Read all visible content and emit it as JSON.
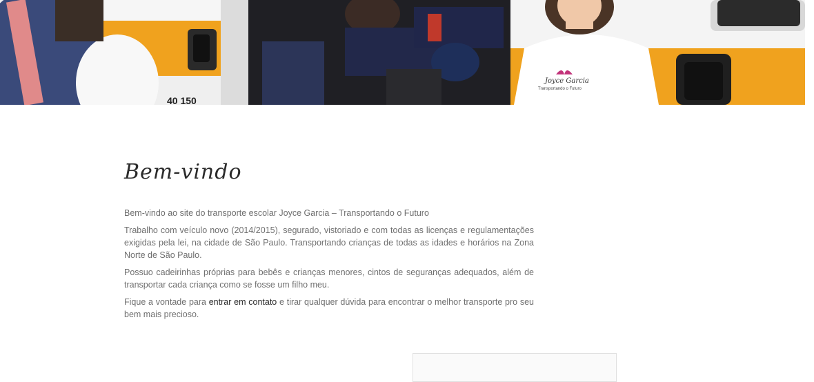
{
  "hero": {
    "shirt_brand": "Joyce Garcia",
    "shirt_tagline": "Transportando o Futuro",
    "van_plate_partial": "40 150"
  },
  "welcome": {
    "title": "Bem-vindo",
    "paragraph_1": "Bem-vindo ao site do transporte escolar Joyce Garcia – Transportando o Futuro",
    "paragraph_2": "Trabalho com veículo novo (2014/2015), segurado, vistoriado e com todas as licenças e regulamentações exigidas pela lei, na cidade de São Paulo.  Transportando crianças de todas as idades e horários na Zona Norte de São Paulo.",
    "paragraph_3": "Possuo cadeirinhas próprias para bebês e crianças menores, cintos de seguranças adequados, além de transportar cada criança como se fosse um filho meu.",
    "paragraph_4_before": "Fique a vontade para ",
    "contact_link": "entrar em contato",
    "paragraph_4_after": " e tirar qualquer dúvida para encontrar o melhor transporte pro seu bem mais precioso."
  },
  "colors": {
    "van_orange": "#f0a21e",
    "van_white": "#f2f2f2",
    "logo_pink": "#c2337a",
    "text_gray": "#6f6f6f"
  }
}
